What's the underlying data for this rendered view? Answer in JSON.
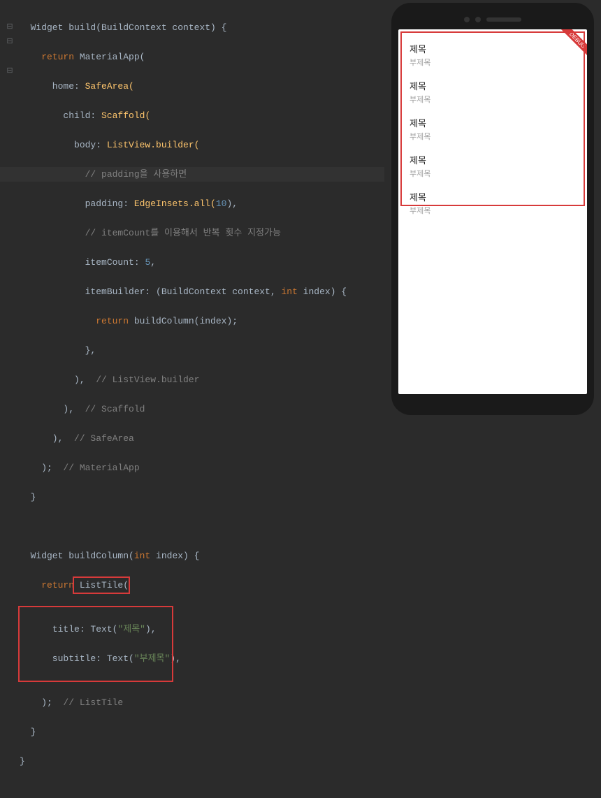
{
  "code": {
    "l1": "  Widget build(BuildContext context) {",
    "l2_kw": "    return",
    "l2_rest": " MaterialApp(",
    "l3_a": "      home: ",
    "l3_b": "SafeArea(",
    "l4_a": "        child: ",
    "l4_b": "Scaffold(",
    "l5_a": "          body: ",
    "l5_b": "ListView.builder(",
    "l6": "            // padding을 사용하면",
    "l7_a": "            padding: ",
    "l7_b": "EdgeInsets.all(",
    "l7_num": "10",
    "l7_c": "),",
    "l8": "            // itemCount를 이용해서 반복 횟수 지정가능",
    "l9_a": "            itemCount: ",
    "l9_num": "5",
    "l9_c": ",",
    "l10_a": "            itemBuilder: (BuildContext context, ",
    "l10_b": "int",
    "l10_c": " index) {",
    "l11_kw": "              return",
    "l11_b": " buildColumn(index);",
    "l12": "            },",
    "l13_a": "          ),  ",
    "l13_cmt": "// ListView.builder",
    "l14_a": "        ),  ",
    "l14_cmt": "// Scaffold",
    "l15_a": "      ),  ",
    "l15_cmt": "// SafeArea",
    "l16_a": "    );  ",
    "l16_cmt": "// MaterialApp",
    "l17": "  }",
    "blank": "",
    "l18": "  Widget buildColumn(",
    "l18_b": "int",
    "l18_c": " index) {",
    "l19_kw": "    return",
    "l19_b": " ListTile(",
    "l20_a": "      title: Text(",
    "l20_str": "\"제목\"",
    "l20_c": "),",
    "l21_a": "      subtitle: Text(",
    "l21_str": "\"부제목\"",
    "l21_c": "),",
    "l22_a": "    );  ",
    "l22_cmt": "// ListTile",
    "l23": "  }",
    "l24": "}"
  },
  "preview": {
    "debug": "DEBUG",
    "tile_title": "제목",
    "tile_sub": "부제목",
    "item_count": 5
  }
}
